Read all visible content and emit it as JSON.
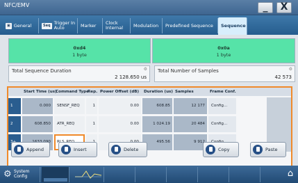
{
  "window": {
    "title": "NFC/EMV",
    "minimize_label": "_",
    "close_label": "X"
  },
  "tabs": [
    {
      "icon_label": "",
      "label": "General"
    },
    {
      "icon_label": "Seq",
      "label": "Trigger In\nAuto"
    },
    {
      "icon_label": "",
      "label": "Marker"
    },
    {
      "icon_label": "",
      "label": "Clock\nInternal"
    },
    {
      "icon_label": "",
      "label": "Modulation"
    },
    {
      "icon_label": "",
      "label": "Predefined Sequence"
    },
    {
      "icon_label": "",
      "label": "Sequence"
    }
  ],
  "segments": [
    {
      "value": "0xd4",
      "unit": "1 byte"
    },
    {
      "value": "0x0a",
      "unit": "1 byte"
    }
  ],
  "summary": {
    "duration_label": "Total Sequence Duration",
    "duration_value": "2 128.650 us",
    "samples_label": "Total Number of Samples",
    "samples_value": "42 573"
  },
  "table": {
    "headers": [
      "Start Time (us)",
      "Command Type",
      "Rep.",
      "Power Offset (dB)",
      "Duration (us)",
      "Samples",
      "Frame Conf."
    ],
    "rows": [
      {
        "index": "1",
        "start": "0.000",
        "command": "SENSF_REQ",
        "rep": "1",
        "power": "0.00",
        "duration": "608.85",
        "samples": "12 177",
        "frame": "Config..."
      },
      {
        "index": "2",
        "start": "608.850",
        "command": "ATR_REQ",
        "rep": "1",
        "power": "0.00",
        "duration": "1 024.19",
        "samples": "20 484",
        "frame": "Config..."
      },
      {
        "index": "3+",
        "start": "1633.090",
        "command": "RLS_REQ",
        "rep": "1",
        "power": "0.00",
        "duration": "495.56",
        "samples": "9 912",
        "frame": "Config..."
      }
    ]
  },
  "actions": {
    "append": "Append",
    "insert": "Insert",
    "delete": "Delete",
    "copy": "Copy",
    "paste": "Paste"
  },
  "taskbar": {
    "system_config": "System\nConfig"
  },
  "colors": {
    "accent_orange": "#f08a2a",
    "segment_green": "#56e3a8",
    "title_blue": "#3e6590"
  }
}
